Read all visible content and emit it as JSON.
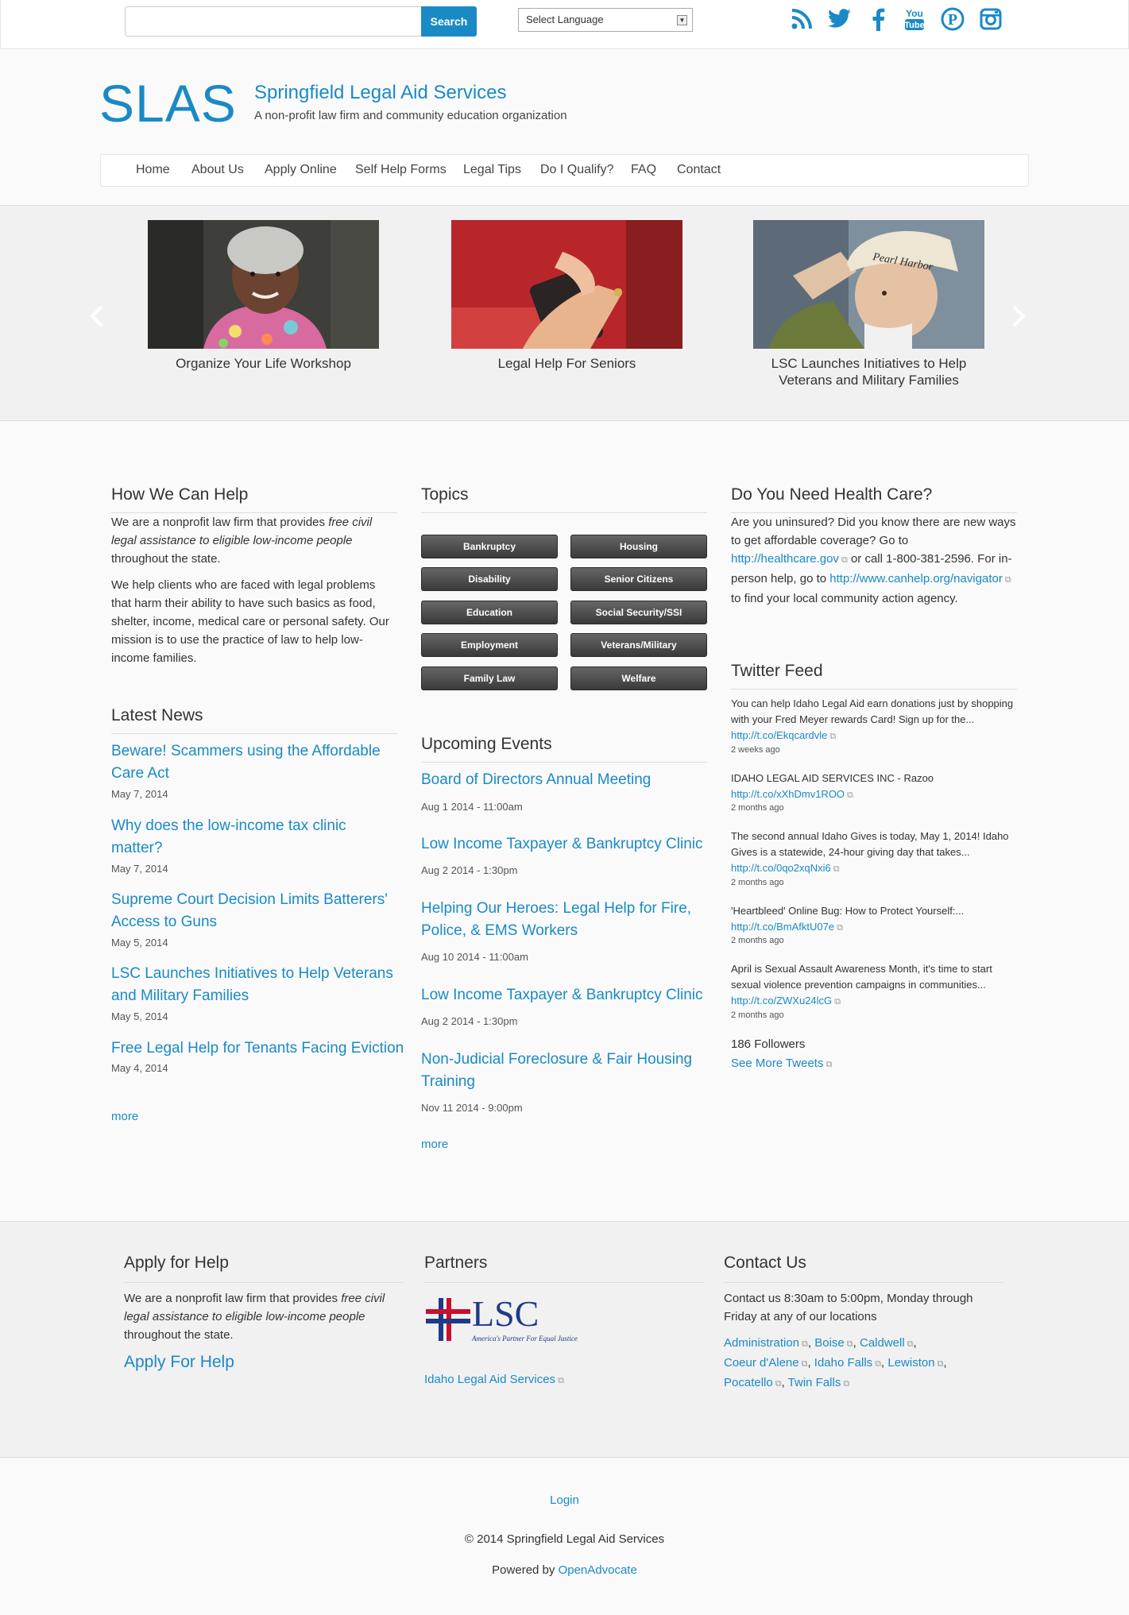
{
  "colors": {
    "accent": "#1a8ac6",
    "topic_button": "#444444"
  },
  "topbar": {
    "search_placeholder": "",
    "search_label": "Search",
    "language_label": "Select Language",
    "social": [
      "rss-icon",
      "twitter-icon",
      "facebook-icon",
      "youtube-icon",
      "pinterest-icon",
      "instagram-icon"
    ]
  },
  "header": {
    "logo": "SLAS",
    "site_name": "Springfield Legal Aid Services",
    "tagline": "A non-profit law firm and community education organization"
  },
  "nav": [
    "Home",
    "About Us",
    "Apply Online",
    "Self Help Forms",
    "Legal Tips",
    "Do I Qualify?",
    "FAQ",
    "Contact"
  ],
  "carousel": [
    {
      "caption": "Organize Your Life Workshop"
    },
    {
      "caption": "Legal Help For Seniors"
    },
    {
      "caption": "LSC Launches Initiatives to Help Veterans and Military Families"
    }
  ],
  "help": {
    "title": "How We Can Help",
    "p1_a": "We are a nonprofit law firm that provides ",
    "p1_em": "free civil legal assistance to eligible low-income people",
    "p1_b": " throughout the state.",
    "p2": "We help clients who are faced with legal problems that harm their ability to have such basics as food, shelter, income, medical care or personal safety. Our mission is to use the practice of law to help low-income families."
  },
  "news": {
    "title": "Latest News",
    "items": [
      {
        "title": "Beware! Scammers using the Affordable Care Act",
        "date": "May 7, 2014"
      },
      {
        "title": "Why does the low-income tax clinic matter?",
        "date": "May 7, 2014"
      },
      {
        "title": "Supreme Court Decision Limits Batterers' Access to Guns",
        "date": "May 5, 2014"
      },
      {
        "title": "LSC Launches Initiatives to Help Veterans and Military Families",
        "date": "May 5, 2014"
      },
      {
        "title": "Free Legal Help for Tenants Facing Eviction",
        "date": "May 4, 2014"
      }
    ],
    "more": "more"
  },
  "topics": {
    "title": "Topics",
    "items": [
      "Bankruptcy",
      "Housing",
      "Disability",
      "Senior Citizens",
      "Education",
      "Social Security/SSI",
      "Employment",
      "Veterans/Military",
      "Family Law",
      "Welfare"
    ]
  },
  "events": {
    "title": "Upcoming Events",
    "items": [
      {
        "title": "Board of Directors Annual Meeting",
        "date": "Aug 1 2014 - 11:00am"
      },
      {
        "title": "Low Income Taxpayer & Bankruptcy Clinic",
        "date": "Aug 2 2014 - 1:30pm"
      },
      {
        "title": "Helping Our Heroes: Legal Help for Fire, Police, & EMS Workers",
        "date": "Aug 10 2014 - 11:00am"
      },
      {
        "title": "Low Income Taxpayer & Bankruptcy Clinic",
        "date": "Aug 2 2014 - 1:30pm"
      },
      {
        "title": "Non-Judicial Foreclosure & Fair Housing Training",
        "date": "Nov 11 2014 - 9:00pm"
      }
    ],
    "more": "more"
  },
  "health": {
    "title": "Do You Need Health Care?",
    "t1": "Are you uninsured? Did you know there are new ways to get affordable coverage? Go to ",
    "link1": "http://healthcare.gov",
    "t2": " or call 1-800-381-2596. For in-person help, go to ",
    "link2": "http://www.canhelp.org/navigator",
    "t3": " to find your local community action agency."
  },
  "twitter": {
    "title": "Twitter Feed",
    "items": [
      {
        "text": "You can help Idaho Legal Aid earn donations just by shopping with your Fred Meyer rewards Card! Sign up for the... ",
        "link": "http://t.co/Ekqcardvle",
        "time": "2 weeks ago"
      },
      {
        "text": "IDAHO LEGAL AID SERVICES INC - Razoo ",
        "link": "http://t.co/xXhDmv1ROO",
        "time": "2 months ago"
      },
      {
        "text": "The second annual Idaho Gives is today, May 1, 2014! Idaho Gives is a statewide, 24-hour giving day that takes... ",
        "link": "http://t.co/0qo2xqNxi6",
        "time": "2 months ago"
      },
      {
        "text": "'Heartbleed' Online Bug: How to Protect Yourself:... ",
        "link": "http://t.co/BmAfktU07e",
        "time": "2 months ago"
      },
      {
        "text": "April is Sexual Assault Awareness Month, it's time to start sexual violence prevention campaigns in communities... ",
        "link": "http://t.co/ZWXu24lcG",
        "time": "2 months ago"
      }
    ],
    "followers": "186 Followers",
    "see_more": "See More Tweets"
  },
  "footer": {
    "apply": {
      "title": "Apply for Help",
      "p_a": "We are a nonprofit law firm that provides ",
      "p_em": "free civil legal assistance to eligible low-income people",
      "p_b": " throughout the state.",
      "link": "Apply For Help"
    },
    "partners": {
      "title": "Partners",
      "lsc_text": "LSC",
      "lsc_tagline": "America's Partner For Equal Justice",
      "link": "Idaho Legal Aid Services"
    },
    "contact": {
      "title": "Contact Us",
      "text": "Contact us 8:30am to 5:00pm, Monday through Friday at any of our locations",
      "locations": [
        "Administration",
        "Boise",
        "Caldwell",
        "Coeur d'Alene",
        "Idaho Falls",
        "Lewiston",
        "Pocatello",
        "Twin Falls"
      ]
    }
  },
  "bottom": {
    "login": "Login",
    "copyright": "© 2014 Springfield Legal Aid Services",
    "powered": "Powered by ",
    "powered_link": "OpenAdvocate"
  }
}
